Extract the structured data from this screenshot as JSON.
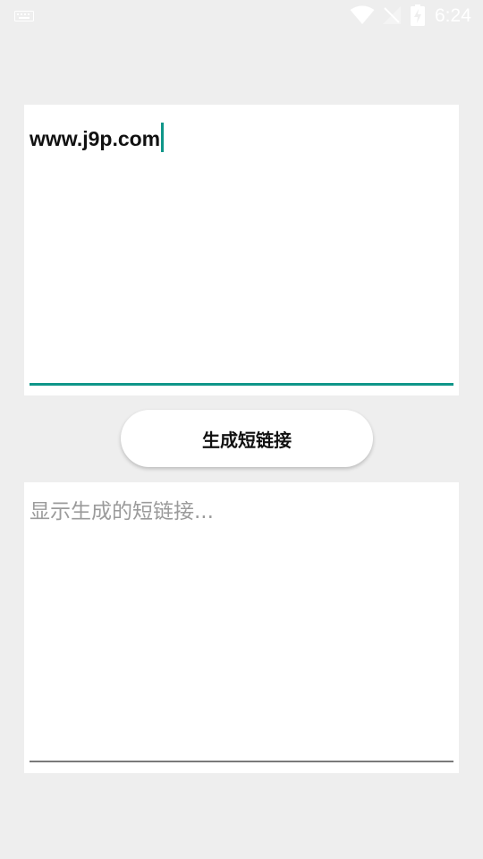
{
  "status_bar": {
    "time": "6:24",
    "icons": [
      "keyboard-icon",
      "wifi-icon",
      "no-signal-icon",
      "battery-charging-icon"
    ],
    "icon_color": "#ffffff"
  },
  "input": {
    "value": "www.j9p.com",
    "accent_color": "#0f9689"
  },
  "generate_button": {
    "label": "生成短链接"
  },
  "output": {
    "placeholder": "显示生成的短链接..."
  },
  "colors": {
    "background": "#eeeeee",
    "card": "#ffffff",
    "placeholder": "#9b9b9b"
  }
}
